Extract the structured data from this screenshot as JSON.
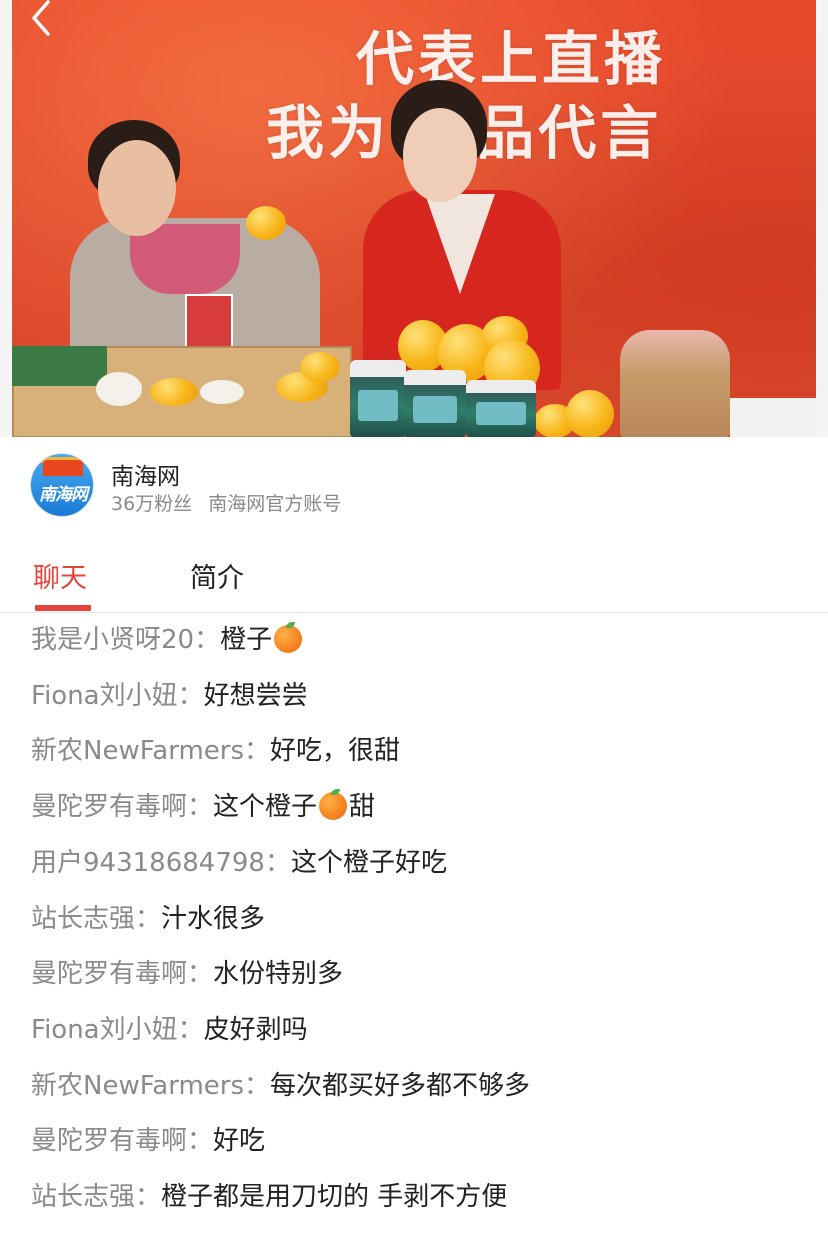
{
  "video": {
    "banner_line1": "代表上直播",
    "banner_line2": "我为  产品代言"
  },
  "account": {
    "avatar_text": "南海网",
    "name": "南海网",
    "followers": "36万粉丝",
    "verification": "南海网官方账号"
  },
  "tabs": {
    "active": "聊天",
    "items": [
      "聊天",
      "简介"
    ]
  },
  "colors": {
    "accent": "#e5443a",
    "username": "#8a8a8a",
    "text": "#222222"
  },
  "chat": [
    {
      "user": "我是小贤呀20",
      "text": "橙子",
      "emoji_after": "orange-emoji"
    },
    {
      "user": "Fiona刘小妞",
      "text": "好想尝尝"
    },
    {
      "user": "新农NewFarmers",
      "text": "好吃，很甜"
    },
    {
      "user": "曼陀罗有毒啊",
      "text": "这个橙子",
      "emoji_mid": "orange-emoji",
      "text2": "甜"
    },
    {
      "user": "用户94318684798",
      "text": "这个橙子好吃"
    },
    {
      "user": "站长志强",
      "text": "汁水很多"
    },
    {
      "user": "曼陀罗有毒啊",
      "text": "水份特别多"
    },
    {
      "user": "Fiona刘小妞",
      "text": "皮好剥吗"
    },
    {
      "user": "新农NewFarmers",
      "text": "每次都买好多都不够多"
    },
    {
      "user": "曼陀罗有毒啊",
      "text": "好吃"
    },
    {
      "user": "站长志强",
      "text": "橙子都是用刀切的 手剥不方便"
    }
  ]
}
